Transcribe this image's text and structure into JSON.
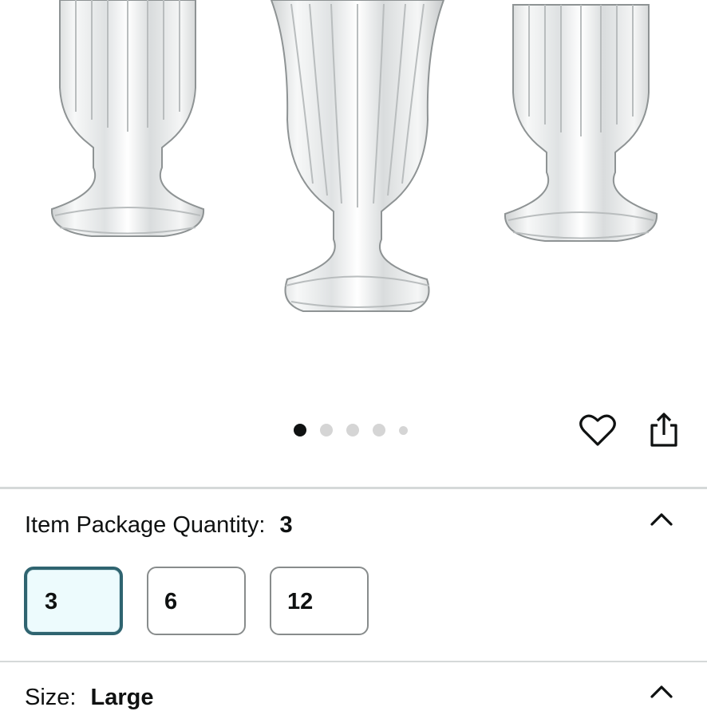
{
  "gallery": {
    "image_alt": "Set of three clear fluted glass pedestal vases",
    "dot_count": 5,
    "active_index": 0,
    "wishlist_icon": "heart-outline-icon",
    "share_icon": "share-icon"
  },
  "package_quantity": {
    "label": "Item Package Quantity:",
    "selected_value": "3",
    "options": [
      "3",
      "6",
      "12"
    ],
    "expanded_icon": "chevron-up-icon"
  },
  "size": {
    "label": "Size:",
    "selected_value": "Large",
    "expanded_icon": "chevron-up-icon"
  },
  "colors": {
    "selected_border": "#2f6470",
    "selected_fill": "#edfbfd",
    "divider": "#d5d9d9"
  }
}
